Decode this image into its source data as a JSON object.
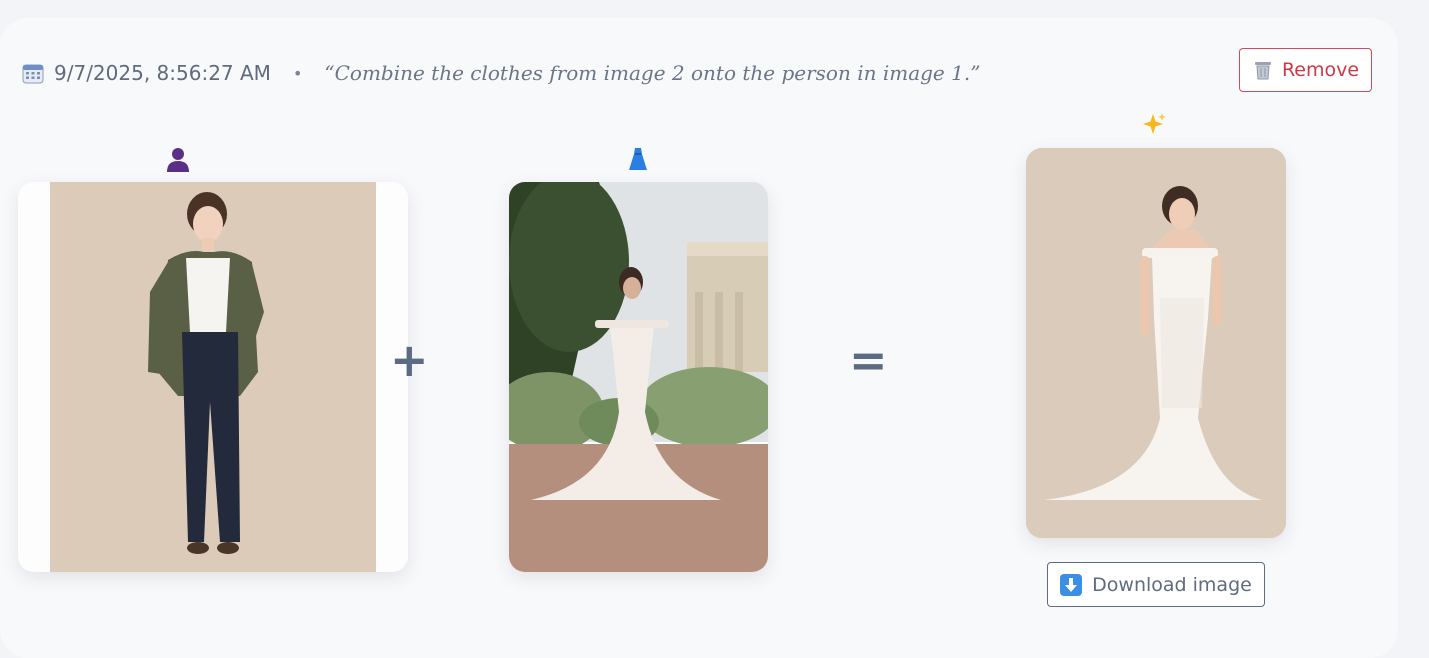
{
  "entry": {
    "timestamp": "9/7/2025, 8:56:27 AM",
    "separator": "•",
    "prompt": "“Combine the clothes from image 2 onto the person in image 1.”"
  },
  "remove_button": {
    "label": "Remove",
    "icon": "trash-icon"
  },
  "inputs": [
    {
      "icon": "person-silhouette-icon",
      "image": "woman-green-blazer-navy-trousers"
    },
    {
      "icon": "dress-icon",
      "image": "lace-wedding-gown-garden"
    }
  ],
  "operators": {
    "plus": "+",
    "equals": "="
  },
  "result": {
    "icon": "sparkles-icon",
    "image": "woman-in-lace-wedding-gown"
  },
  "download_button": {
    "label": "Download image",
    "icon": "download-arrow-icon"
  },
  "colors": {
    "remove_accent": "#cf3848",
    "text_muted": "#5f6b7e",
    "download_icon": "#3a8fe4",
    "person_icon": "#5b2f86",
    "dress_icon": "#2c7fe0"
  }
}
